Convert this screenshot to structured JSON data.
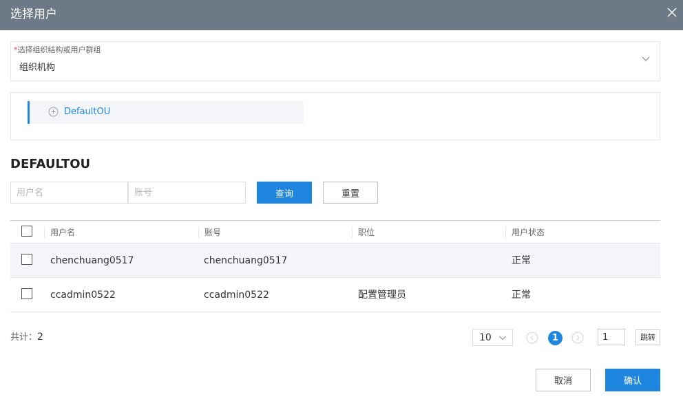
{
  "dialog": {
    "title": "选择用户",
    "close_icon": "close-icon"
  },
  "org_select": {
    "required_mark": "*",
    "label": "选择组织结构或用户群组",
    "value": "组织机构",
    "icon": "chevron-down-icon"
  },
  "tree": {
    "node_label": "DefaultOU",
    "node_icon": "plus-circle-icon"
  },
  "section": {
    "title": "DEFAULTOU"
  },
  "filters": {
    "username_placeholder": "用户名",
    "account_placeholder": "账号",
    "search_label": "查询",
    "reset_label": "重置"
  },
  "table": {
    "columns": [
      "用户名",
      "账号",
      "职位",
      "用户状态"
    ],
    "rows": [
      {
        "username": "chenchuang0517",
        "account": "chenchuang0517",
        "position": "",
        "status": "正常"
      },
      {
        "username": "ccadmin0522",
        "account": "ccadmin0522",
        "position": "配置管理员",
        "status": "正常"
      }
    ]
  },
  "pagination": {
    "total_label": "共计：",
    "total": "2",
    "page_size": "10",
    "current_page": "1",
    "jump_value": "1",
    "jump_label": "跳转"
  },
  "footer": {
    "cancel_label": "取消",
    "confirm_label": "确认"
  },
  "colors": {
    "header_bg": "#6e7987",
    "primary": "#1f86e0",
    "required": "#e4393c",
    "row_highlight": "#f3f5f8"
  }
}
